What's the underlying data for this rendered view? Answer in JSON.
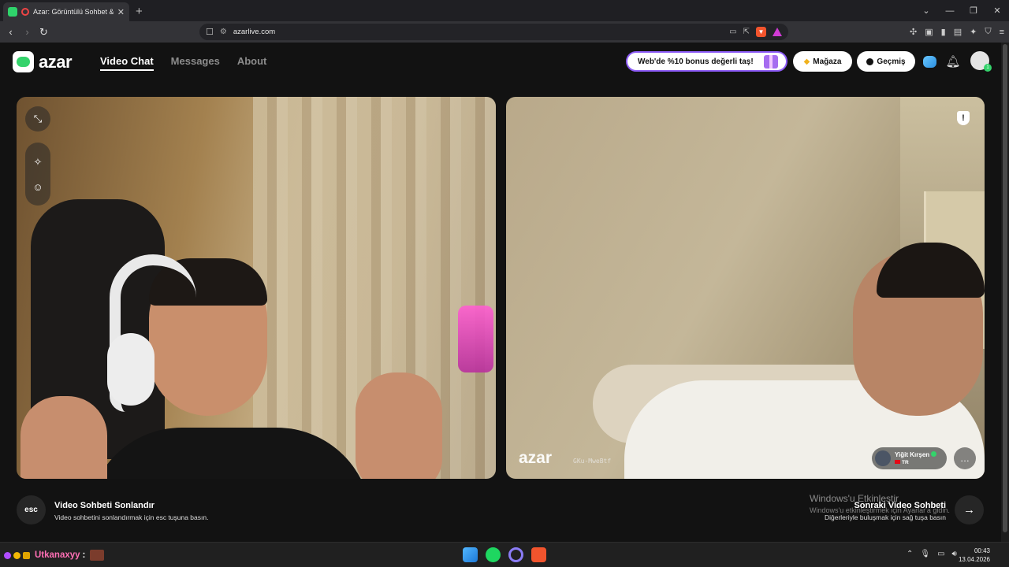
{
  "browser": {
    "tab_title": "Azar: Görüntülü Sohbet & Yeni",
    "url": "azarlive.com",
    "tab_close": "✕",
    "new_tab": "+"
  },
  "app": {
    "logo_text": "azar",
    "nav": [
      {
        "label": "Video Chat",
        "active": true
      },
      {
        "label": "Messages",
        "active": false
      },
      {
        "label": "About",
        "active": false
      }
    ],
    "promo_label": "Web'de %10 bonus değerli taş!",
    "store_label": "Mağaza",
    "history_label": "Geçmiş",
    "avatar_badge": "1"
  },
  "remote": {
    "watermark": "azar",
    "watermark_id": "GKu-MweBtf",
    "user_name": "Yiğit Kırşen",
    "user_country": "TR"
  },
  "actions": {
    "esc_key": "esc",
    "end_title": "Video Sohbeti Sonlandır",
    "end_subtitle": "Video sohbetini sonlandırmak için esc tuşuna basın.",
    "next_title": "Sonraki Video Sohbeti",
    "next_subtitle": "Diğerleriyle buluşmak için sağ tuşa basın"
  },
  "windows_watermark": {
    "line1": "Windows'u Etkinleştir",
    "line2": "Windows'u etkinleştirmek için Ayarlar'a gidin."
  },
  "taskbar": {
    "streamer_name": "Utkanaxyy",
    "separator": ":",
    "time": "00:43",
    "date": "13.04.2026"
  },
  "colors": {
    "accent_green": "#34d36b",
    "promo_border": "#8d5cf6",
    "streamer_pink": "#ff6fb5"
  }
}
